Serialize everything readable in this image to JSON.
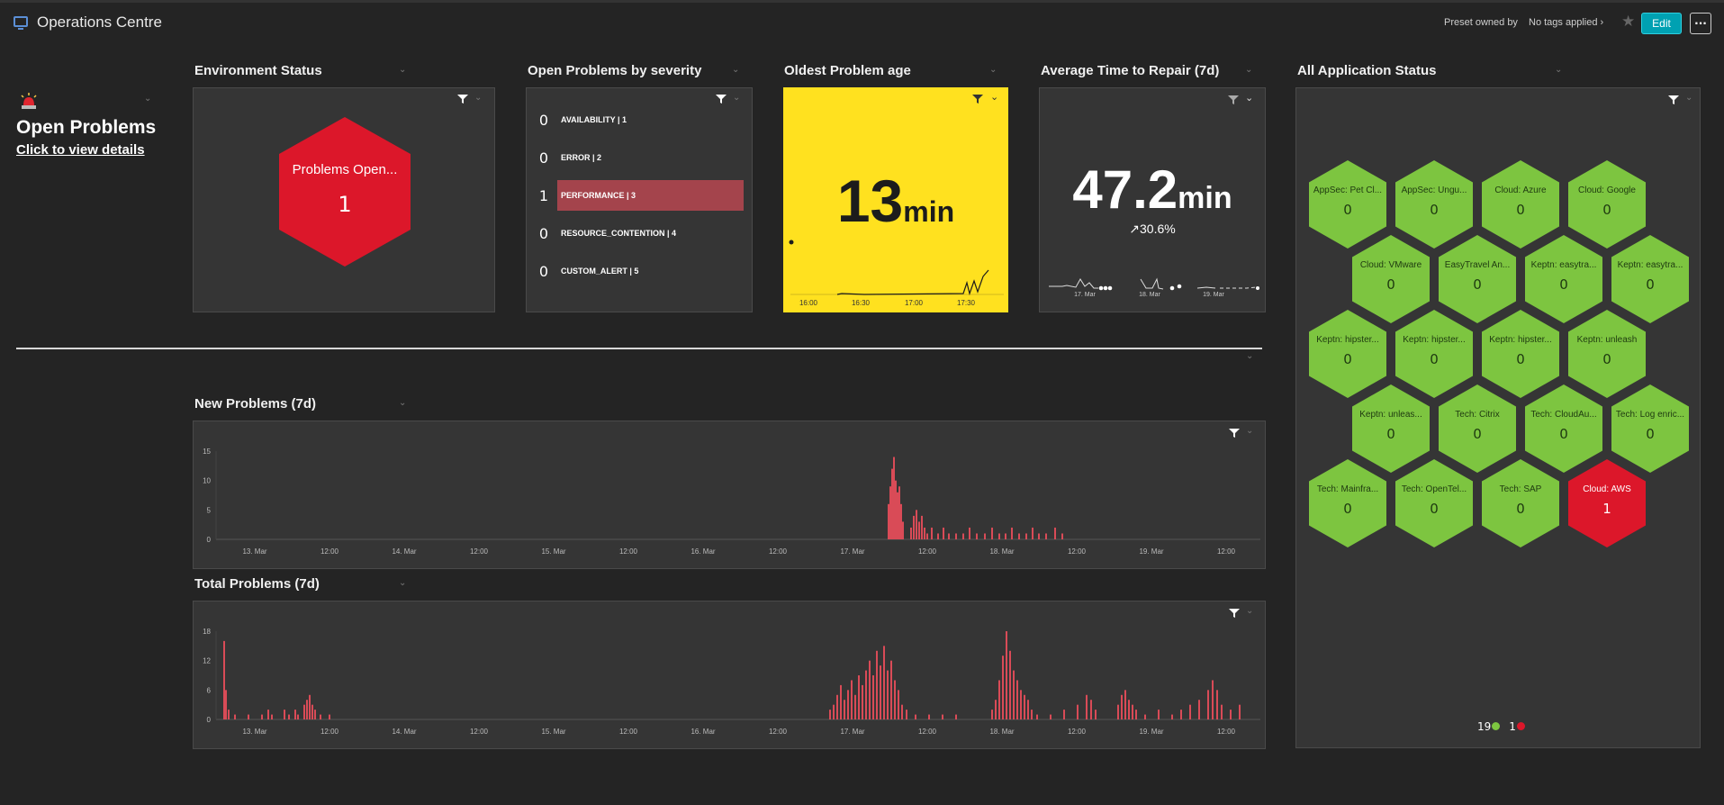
{
  "header": {
    "title": "Operations Centre",
    "preset_label": "Preset owned by",
    "tags_label": "No tags applied",
    "edit_label": "Edit",
    "more_label": "···"
  },
  "open_problems": {
    "title": "Open Problems",
    "link": "Click to view details"
  },
  "environment_status": {
    "title": "Environment Status",
    "hex_label": "Problems Open...",
    "hex_value": "1"
  },
  "severity": {
    "title": "Open Problems by severity",
    "rows": [
      {
        "count": "0",
        "label": "AVAILABILITY | 1",
        "highlight": false
      },
      {
        "count": "0",
        "label": "ERROR | 2",
        "highlight": false
      },
      {
        "count": "1",
        "label": "PERFORMANCE | 3",
        "highlight": true
      },
      {
        "count": "0",
        "label": "RESOURCE_CONTENTION | 4",
        "highlight": false
      },
      {
        "count": "0",
        "label": "CUSTOM_ALERT | 5",
        "highlight": false
      }
    ]
  },
  "oldest": {
    "title": "Oldest Problem age",
    "value": "13",
    "unit": "min",
    "ticks": [
      "16:00",
      "16:30",
      "17:00",
      "17:30"
    ]
  },
  "mttr": {
    "title": "Average Time to Repair (7d)",
    "value": "47.2",
    "unit": "min",
    "change": "↗30.6%",
    "ticks": [
      "17. Mar",
      "18. Mar",
      "19. Mar"
    ]
  },
  "app_status": {
    "title": "All Application Status",
    "apps": [
      {
        "label": "AppSec: Pet Cl...",
        "value": "0",
        "status": "ok"
      },
      {
        "label": "AppSec: Ungu...",
        "value": "0",
        "status": "ok"
      },
      {
        "label": "Cloud: Azure",
        "value": "0",
        "status": "ok"
      },
      {
        "label": "Cloud: Google",
        "value": "0",
        "status": "ok"
      },
      {
        "label": "Cloud: VMware",
        "value": "0",
        "status": "ok"
      },
      {
        "label": "EasyTravel An...",
        "value": "0",
        "status": "ok"
      },
      {
        "label": "Keptn: easytra...",
        "value": "0",
        "status": "ok"
      },
      {
        "label": "Keptn: easytra...",
        "value": "0",
        "status": "ok"
      },
      {
        "label": "Keptn: hipster...",
        "value": "0",
        "status": "ok"
      },
      {
        "label": "Keptn: hipster...",
        "value": "0",
        "status": "ok"
      },
      {
        "label": "Keptn: hipster...",
        "value": "0",
        "status": "ok"
      },
      {
        "label": "Keptn: unleash",
        "value": "0",
        "status": "ok"
      },
      {
        "label": "Keptn: unleas...",
        "value": "0",
        "status": "ok"
      },
      {
        "label": "Tech: Citrix",
        "value": "0",
        "status": "ok"
      },
      {
        "label": "Tech: CloudAu...",
        "value": "0",
        "status": "ok"
      },
      {
        "label": "Tech: Log enric...",
        "value": "0",
        "status": "ok"
      },
      {
        "label": "Tech: Mainfra...",
        "value": "0",
        "status": "ok"
      },
      {
        "label": "Tech: OpenTel...",
        "value": "0",
        "status": "ok"
      },
      {
        "label": "Tech: SAP",
        "value": "0",
        "status": "ok"
      },
      {
        "label": "Cloud: AWS",
        "value": "1",
        "status": "problem"
      }
    ],
    "ok_count": "19",
    "problem_count": "1",
    "colors": {
      "ok": "#7dc540",
      "problem": "#dc172a"
    }
  },
  "new_problems": {
    "title": "New Problems (7d)",
    "yticks": [
      "15",
      "10",
      "5",
      "0"
    ],
    "xticks": [
      "13. Mar",
      "12:00",
      "14. Mar",
      "12:00",
      "15. Mar",
      "12:00",
      "16. Mar",
      "12:00",
      "17. Mar",
      "12:00",
      "18. Mar",
      "12:00",
      "19. Mar",
      "12:00"
    ]
  },
  "total_problems": {
    "title": "Total Problems (7d)",
    "yticks": [
      "18",
      "12",
      "6",
      "0"
    ],
    "xticks": [
      "13. Mar",
      "12:00",
      "14. Mar",
      "12:00",
      "15. Mar",
      "12:00",
      "16. Mar",
      "12:00",
      "17. Mar",
      "12:00",
      "18. Mar",
      "12:00",
      "19. Mar",
      "12:00"
    ]
  },
  "colors": {
    "accent": "#00a1b2",
    "problem_red": "#dc172a",
    "bar_red": "#d94b57",
    "yellow": "#ffe11f"
  }
}
